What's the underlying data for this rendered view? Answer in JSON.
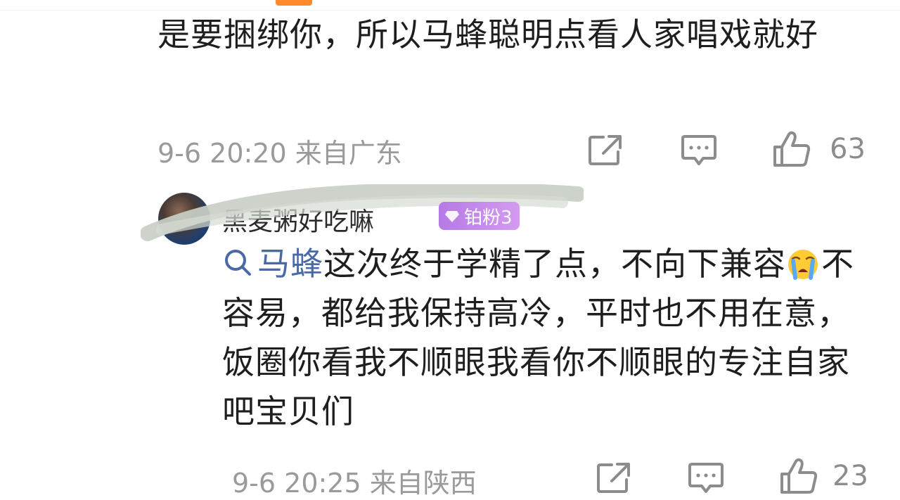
{
  "comment1": {
    "text": "是要捆绑你，所以马蜂聪明点看人家唱戏就好",
    "time": "9-6 20:20",
    "location": "来自广东",
    "likes": "63"
  },
  "comment2": {
    "username": "黑麦粥好吃嘛",
    "badge": "铂粉3",
    "topic": "马蜂",
    "text_before_emoji": "这次终于学精了点，不向下兼容",
    "emoji": "crying-face",
    "text_after_emoji": "不容易，都给我保持高冷，平时也不用在意，饭圈你看我不顺眼我看你不顺眼的专注自家吧宝贝们",
    "time": "9-6 20:25",
    "location": "来自陕西",
    "likes": "23"
  },
  "colors": {
    "accent_tab": "#ff8a2b",
    "topic_link": "#4a6aa6",
    "meta_text": "#9a9a9a",
    "badge": "#c58aec"
  },
  "icons": [
    "share-icon",
    "comment-icon",
    "like-icon",
    "search-icon",
    "crying-emoji-icon",
    "diamond-icon"
  ]
}
